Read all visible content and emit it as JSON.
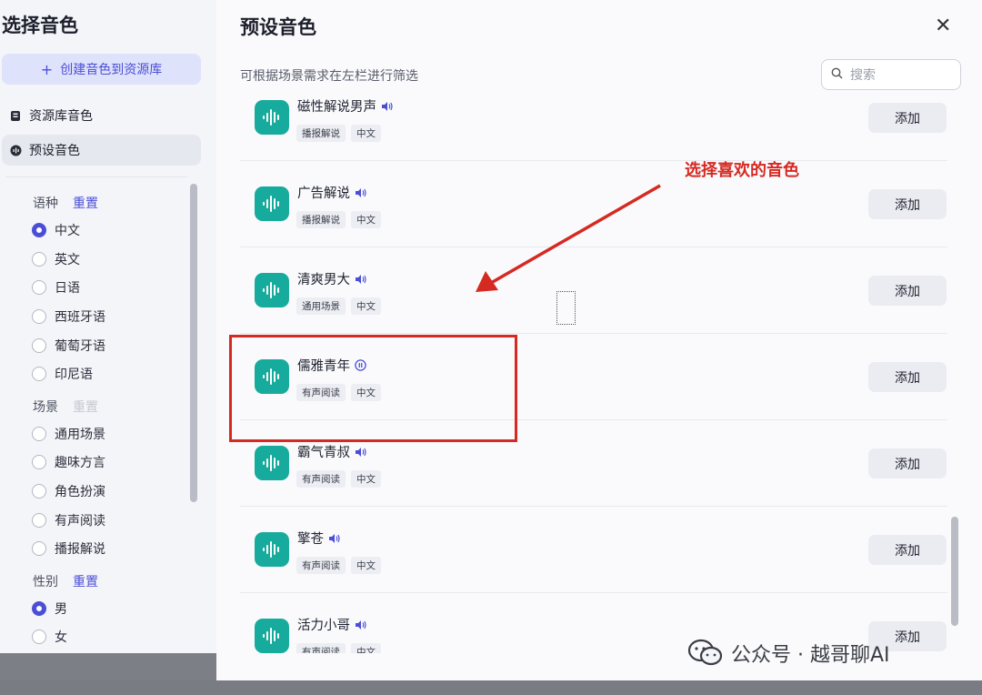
{
  "left": {
    "title": "选择音色",
    "create_label": "创建音色到资源库",
    "nav": [
      {
        "label": "资源库音色",
        "icon": "library-icon",
        "active": false
      },
      {
        "label": "预设音色",
        "icon": "voice-icon",
        "active": true
      }
    ],
    "filters": {
      "language": {
        "title": "语种",
        "reset": "重置",
        "options": [
          "中文",
          "英文",
          "日语",
          "西班牙语",
          "葡萄牙语",
          "印尼语"
        ],
        "selected": "中文"
      },
      "scene": {
        "title": "场景",
        "reset": "重置",
        "options": [
          "通用场景",
          "趣味方言",
          "角色扮演",
          "有声阅读",
          "播报解说"
        ]
      },
      "gender": {
        "title": "性别",
        "reset": "重置",
        "options": [
          "男",
          "女"
        ],
        "selected": "男"
      }
    }
  },
  "dialog": {
    "title": "预设音色",
    "subtitle": "可根据场景需求在左栏进行筛选",
    "search_placeholder": "搜索",
    "add_label": "添加",
    "voices": [
      {
        "name": "磁性解说男声",
        "tags": [
          "播报解说",
          "中文"
        ],
        "status": "speaker"
      },
      {
        "name": "广告解说",
        "tags": [
          "播报解说",
          "中文"
        ],
        "status": "speaker"
      },
      {
        "name": "清爽男大",
        "tags": [
          "通用场景",
          "中文"
        ],
        "status": "speaker"
      },
      {
        "name": "儒雅青年",
        "tags": [
          "有声阅读",
          "中文"
        ],
        "status": "pause"
      },
      {
        "name": "霸气青叔",
        "tags": [
          "有声阅读",
          "中文"
        ],
        "status": "speaker"
      },
      {
        "name": "擎苍",
        "tags": [
          "有声阅读",
          "中文"
        ],
        "status": "speaker"
      },
      {
        "name": "活力小哥",
        "tags": [
          "有声阅读",
          "中文"
        ],
        "status": "speaker"
      }
    ]
  },
  "annotation": {
    "text": "选择喜欢的音色",
    "color": "#d52a22"
  },
  "watermark": "公众号 · 越哥聊AI",
  "colors": {
    "accent": "#4b4fd6",
    "avatar": "#16ab9c"
  }
}
